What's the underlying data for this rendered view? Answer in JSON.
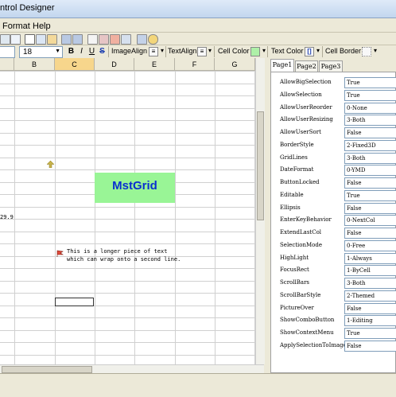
{
  "window": {
    "title": "ntrol Designer"
  },
  "menu": {
    "format_label": "Format",
    "help_label": "Help"
  },
  "format_bar": {
    "name_value": "",
    "size_value": "18",
    "bold": "B",
    "italic": "I",
    "underline": "U",
    "strike": "S",
    "image_align_label": "ImageAlign",
    "text_align_label": "TextAlign",
    "cell_color_label": "Cell Color",
    "text_color_label": "Text Color",
    "cell_border_label": "Cell Border"
  },
  "grid": {
    "columns": [
      "B",
      "C",
      "D",
      "E",
      "F",
      "G"
    ],
    "selected_column": "C",
    "merged_cell_text": "MstGrid",
    "number_cell": "29.9",
    "comment_lines": [
      "This is a longer piece of text",
      "which can wrap onto a second line."
    ]
  },
  "properties": {
    "tabs": [
      "Page1",
      "Page2",
      "Page3"
    ],
    "active_tab": "Page1",
    "rows": [
      {
        "name": "AllowBigSelection",
        "value": "True"
      },
      {
        "name": "AllowSelection",
        "value": "True"
      },
      {
        "name": "AllowUserReorder",
        "value": "0-None"
      },
      {
        "name": "AllowUserResizing",
        "value": "3-Both"
      },
      {
        "name": "AllowUserSort",
        "value": "False"
      },
      {
        "name": "BorderStyle",
        "value": "2-Fixed3D"
      },
      {
        "name": "GridLines",
        "value": "3-Both"
      },
      {
        "name": "DateFormat",
        "value": "0-YMD"
      },
      {
        "name": "ButtonLocked",
        "value": "False"
      },
      {
        "name": "Editable",
        "value": "True"
      },
      {
        "name": "Ellipsis",
        "value": "False"
      },
      {
        "name": "EnterKeyBehavior",
        "value": "0-NextCol"
      },
      {
        "name": "ExtendLastCol",
        "value": "False"
      },
      {
        "name": "SelectionMode",
        "value": "0-Free"
      },
      {
        "name": "HighLight",
        "value": "1-Always"
      },
      {
        "name": "FocusRect",
        "value": "1-ByCell"
      },
      {
        "name": "ScrollBars",
        "value": "3-Both"
      },
      {
        "name": "ScrollBarStyle",
        "value": "2-Themed"
      },
      {
        "name": "PictureOver",
        "value": "False"
      },
      {
        "name": "ShowComboButton",
        "value": "1-Editing"
      },
      {
        "name": "ShowContextMenu",
        "value": "True"
      },
      {
        "name": "ApplySelectionToImage",
        "value": "False"
      }
    ]
  },
  "colors": {
    "merged_bg": "#99f596",
    "merged_text": "#0a2fd0",
    "selected_header": "#f7d68c"
  }
}
